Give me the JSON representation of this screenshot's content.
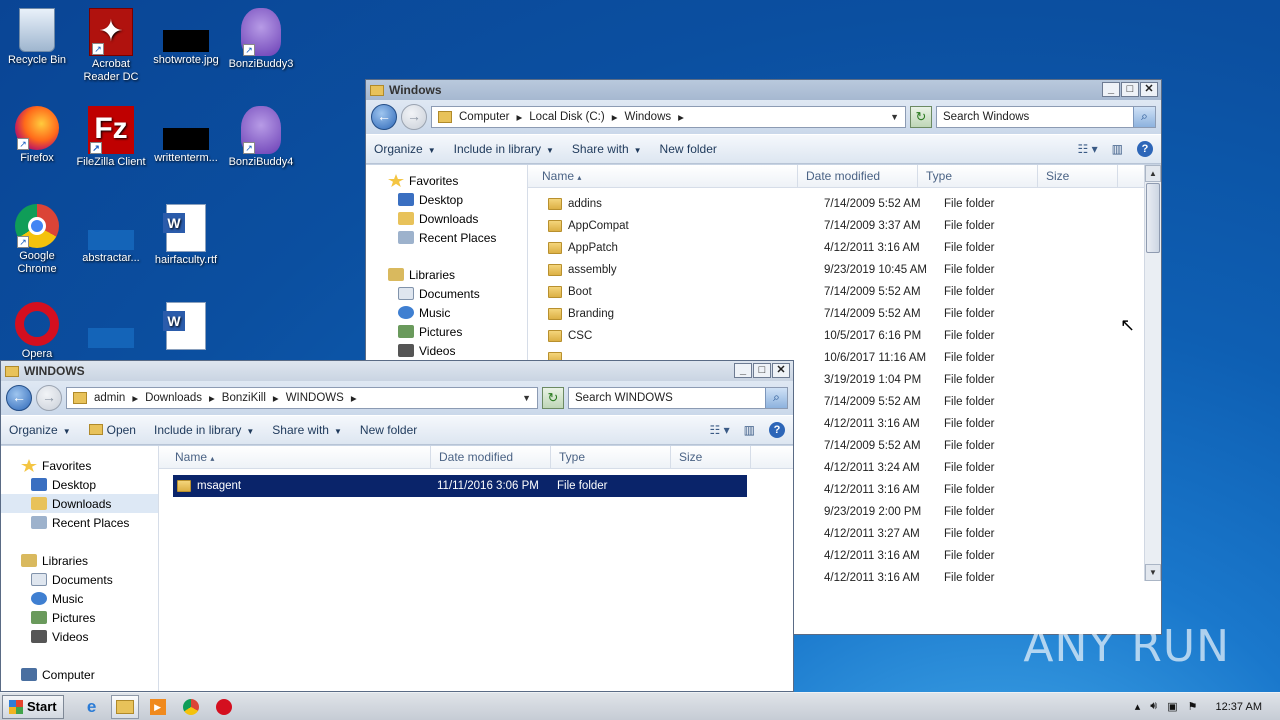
{
  "desktop": {
    "icons": [
      {
        "label": "Recycle Bin"
      },
      {
        "label": "Acrobat Reader DC"
      },
      {
        "label": "shotwrote.jpg"
      },
      {
        "label": "BonziBuddy3"
      },
      {
        "label": "Firefox"
      },
      {
        "label": "FileZilla Client"
      },
      {
        "label": "writtenterm..."
      },
      {
        "label": "BonziBuddy4"
      },
      {
        "label": "Google Chrome"
      },
      {
        "label": "abstractar..."
      },
      {
        "label": "hairfaculty.rtf"
      },
      {
        "label": "Opera"
      },
      {
        "label": "..."
      },
      {
        "label": "..."
      }
    ]
  },
  "win_back": {
    "title": "Windows",
    "breadcrumb": [
      "Computer",
      "Local Disk (C:)",
      "Windows"
    ],
    "search_placeholder": "Search Windows",
    "commands": {
      "organize": "Organize",
      "include": "Include in library",
      "share": "Share with",
      "new_folder": "New folder"
    },
    "nav": {
      "favorites": "Favorites",
      "fav_items": [
        "Desktop",
        "Downloads",
        "Recent Places"
      ],
      "libraries": "Libraries",
      "lib_items": [
        "Documents",
        "Music",
        "Pictures",
        "Videos"
      ]
    },
    "columns": {
      "name": "Name",
      "date": "Date modified",
      "type": "Type",
      "size": "Size"
    },
    "rows": [
      {
        "name": "addins",
        "date": "7/14/2009 5:52 AM",
        "type": "File folder"
      },
      {
        "name": "AppCompat",
        "date": "7/14/2009 3:37 AM",
        "type": "File folder"
      },
      {
        "name": "AppPatch",
        "date": "4/12/2011 3:16 AM",
        "type": "File folder"
      },
      {
        "name": "assembly",
        "date": "9/23/2019 10:45 AM",
        "type": "File folder"
      },
      {
        "name": "Boot",
        "date": "7/14/2009 5:52 AM",
        "type": "File folder"
      },
      {
        "name": "Branding",
        "date": "7/14/2009 5:52 AM",
        "type": "File folder"
      },
      {
        "name": "CSC",
        "date": "10/5/2017 6:16 PM",
        "type": "File folder"
      },
      {
        "name": "",
        "date": "10/6/2017 11:16 AM",
        "type": "File folder"
      },
      {
        "name": "",
        "date": "3/19/2019 1:04 PM",
        "type": "File folder"
      },
      {
        "name": "",
        "date": "7/14/2009 5:52 AM",
        "type": "File folder"
      },
      {
        "name": "",
        "date": "4/12/2011 3:16 AM",
        "type": "File folder"
      },
      {
        "name": "",
        "date": "7/14/2009 5:52 AM",
        "type": "File folder"
      },
      {
        "name": "",
        "date": "4/12/2011 3:24 AM",
        "type": "File folder"
      },
      {
        "name": "",
        "date": "4/12/2011 3:16 AM",
        "type": "File folder"
      },
      {
        "name": "",
        "date": "9/23/2019 2:00 PM",
        "type": "File folder"
      },
      {
        "name": "",
        "date": "4/12/2011 3:27 AM",
        "type": "File folder"
      },
      {
        "name": "",
        "date": "4/12/2011 3:16 AM",
        "type": "File folder"
      },
      {
        "name": "",
        "date": "4/12/2011 3:16 AM",
        "type": "File folder"
      }
    ]
  },
  "win_front": {
    "title": "WINDOWS",
    "breadcrumb": [
      "admin",
      "Downloads",
      "BonziKill",
      "WINDOWS"
    ],
    "search_placeholder": "Search WINDOWS",
    "commands": {
      "organize": "Organize",
      "open": "Open",
      "include": "Include in library",
      "share": "Share with",
      "new_folder": "New folder"
    },
    "nav": {
      "favorites": "Favorites",
      "fav_items": [
        "Desktop",
        "Downloads",
        "Recent Places"
      ],
      "libraries": "Libraries",
      "lib_items": [
        "Documents",
        "Music",
        "Pictures",
        "Videos"
      ],
      "computer": "Computer"
    },
    "columns": {
      "name": "Name",
      "date": "Date modified",
      "type": "Type",
      "size": "Size"
    },
    "rows": [
      {
        "name": "msagent",
        "date": "11/11/2016 3:06 PM",
        "type": "File folder"
      }
    ]
  },
  "taskbar": {
    "start": "Start",
    "clock": "12:37 AM"
  },
  "watermark": "ANY RUN"
}
